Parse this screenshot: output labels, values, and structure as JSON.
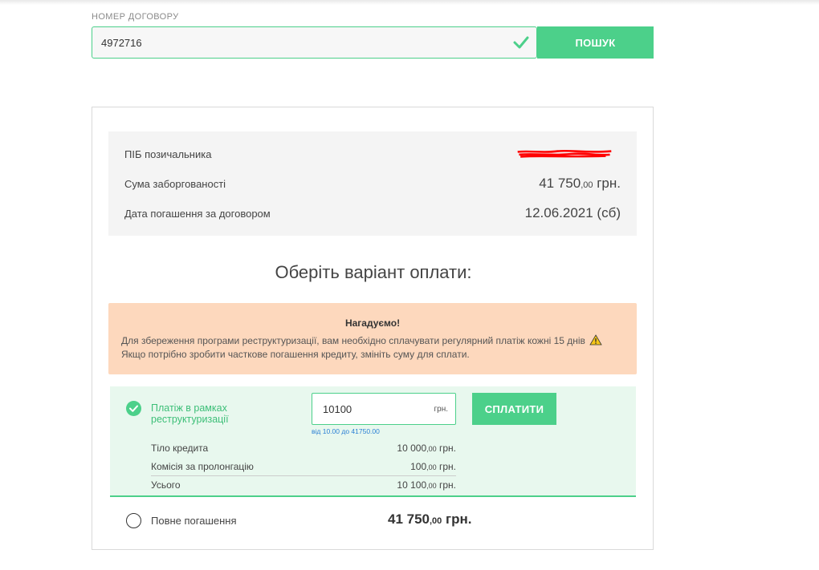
{
  "search": {
    "label": "НОМЕР ДОГОВОРУ",
    "value": "4972716",
    "button": "ПОШУК"
  },
  "info": {
    "borrower_label": "ПІБ позичальника",
    "debt_label": "Сума заборгованості",
    "debt_main": "41 750",
    "debt_cents": ",00",
    "debt_currency": " грн.",
    "due_label": "Дата погашення за договором",
    "due_value": "12.06.2021 (сб)"
  },
  "payment": {
    "title": "Оберіть варіант оплати:",
    "reminder_title": "Нагадуємо!",
    "reminder_text_1": "Для збереження програми реструктуризації, вам необхідно сплачувати регулярний платіж кожні 15 днів",
    "reminder_text_2": " Якщо потрібно зробити часткове погашення кредиту, змініть суму для сплати.",
    "option1_label": "Платіж в рамках реструктуризації",
    "amount_value": "10100",
    "amount_currency": "грн.",
    "range_hint": "від 10.00 до 41750.00",
    "pay_button": "СПЛАТИТИ",
    "breakdown": [
      {
        "label": "Тіло кредита",
        "main": "10 000",
        "cents": ",00",
        "cur": " грн."
      },
      {
        "label": "Комісія за пролонгацію",
        "main": "100",
        "cents": ",00",
        "cur": " грн."
      },
      {
        "label": "Усього",
        "main": "10 100",
        "cents": ",00",
        "cur": " грн."
      }
    ],
    "option2_label": "Повне погашення",
    "full_main": "41 750",
    "full_cents": ",00",
    "full_currency": " грн."
  },
  "colors": {
    "accent": "#4cd08a",
    "warning_bg": "#fdd8bd",
    "option_bg": "#e8f8ee",
    "redaction": "#ff0000"
  }
}
